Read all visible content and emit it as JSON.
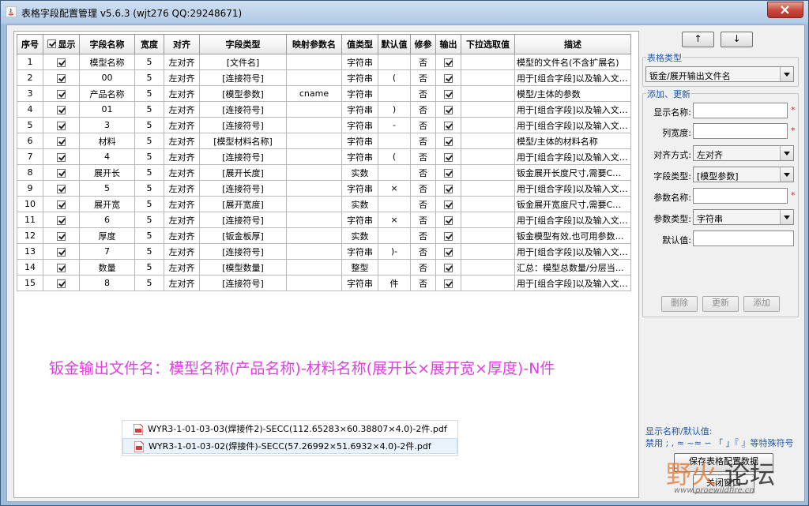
{
  "window": {
    "title": "表格字段配置管理 v5.6.3 (wjt276 QQ:29248671)"
  },
  "table": {
    "columns": [
      "序号",
      "显示",
      "字段名称",
      "宽度",
      "对齐",
      "字段类型",
      "映射参数名",
      "值类型",
      "默认值",
      "修参",
      "输出",
      "下拉选取值",
      "描述"
    ],
    "rows": [
      {
        "no": "1",
        "name": "模型名称",
        "width": "5",
        "align": "左对齐",
        "ftype": "[文件名]",
        "map": "",
        "vtype": "字符串",
        "def": "",
        "mod": "否",
        "desc": "模型的文件名(不含扩展名)"
      },
      {
        "no": "2",
        "name": "00",
        "width": "5",
        "align": "左对齐",
        "ftype": "[连接符号]",
        "map": "",
        "vtype": "字符串",
        "def": "(",
        "mod": "否",
        "desc": "用于[组合字段]以及输入文…"
      },
      {
        "no": "3",
        "name": "产品名称",
        "width": "5",
        "align": "左对齐",
        "ftype": "[模型参数]",
        "map": "cname",
        "vtype": "字符串",
        "def": "",
        "mod": "否",
        "desc": "模型/主体的参数"
      },
      {
        "no": "4",
        "name": "01",
        "width": "5",
        "align": "左对齐",
        "ftype": "[连接符号]",
        "map": "",
        "vtype": "字符串",
        "def": ")",
        "mod": "否",
        "desc": "用于[组合字段]以及输入文…"
      },
      {
        "no": "5",
        "name": "3",
        "width": "5",
        "align": "左对齐",
        "ftype": "[连接符号]",
        "map": "",
        "vtype": "字符串",
        "def": "-",
        "mod": "否",
        "desc": "用于[组合字段]以及输入文…"
      },
      {
        "no": "6",
        "name": "材料",
        "width": "5",
        "align": "左对齐",
        "ftype": "[模型材料名称]",
        "map": "",
        "vtype": "字符串",
        "def": "",
        "mod": "否",
        "desc": "模型/主体的材料名称"
      },
      {
        "no": "7",
        "name": "4",
        "width": "5",
        "align": "左对齐",
        "ftype": "[连接符号]",
        "map": "",
        "vtype": "字符串",
        "def": "(",
        "mod": "否",
        "desc": "用于[组合字段]以及输入文…"
      },
      {
        "no": "8",
        "name": "展开长",
        "width": "5",
        "align": "左对齐",
        "ftype": "[展开长度]",
        "map": "",
        "vtype": "实数",
        "def": "",
        "mod": "否",
        "desc": "钣金展开长度尺寸,需要C…"
      },
      {
        "no": "9",
        "name": "5",
        "width": "5",
        "align": "左对齐",
        "ftype": "[连接符号]",
        "map": "",
        "vtype": "字符串",
        "def": "×",
        "mod": "否",
        "desc": "用于[组合字段]以及输入文…"
      },
      {
        "no": "10",
        "name": "展开宽",
        "width": "5",
        "align": "左对齐",
        "ftype": "[展开宽度]",
        "map": "",
        "vtype": "实数",
        "def": "",
        "mod": "否",
        "desc": "钣金展开宽度尺寸,需要C…"
      },
      {
        "no": "11",
        "name": "6",
        "width": "5",
        "align": "左对齐",
        "ftype": "[连接符号]",
        "map": "",
        "vtype": "字符串",
        "def": "×",
        "mod": "否",
        "desc": "用于[组合字段]以及输入文…"
      },
      {
        "no": "12",
        "name": "厚度",
        "width": "5",
        "align": "左对齐",
        "ftype": "[钣金板厚]",
        "map": "",
        "vtype": "实数",
        "def": "",
        "mod": "否",
        "desc": "钣金模型有效,也可用参数…"
      },
      {
        "no": "13",
        "name": "7",
        "width": "5",
        "align": "左对齐",
        "ftype": "[连接符号]",
        "map": "",
        "vtype": "字符串",
        "def": ")-",
        "mod": "否",
        "desc": "用于[组合字段]以及输入文…"
      },
      {
        "no": "14",
        "name": "数量",
        "width": "5",
        "align": "左对齐",
        "ftype": "[模型数量]",
        "map": "",
        "vtype": "整型",
        "def": "",
        "mod": "否",
        "desc": "汇总：模型总数量/分层当…"
      },
      {
        "no": "15",
        "name": "8",
        "width": "5",
        "align": "左对齐",
        "ftype": "[连接符号]",
        "map": "",
        "vtype": "字符串",
        "def": "件",
        "mod": "否",
        "desc": "用于[组合字段]以及输入文…"
      }
    ]
  },
  "note": "钣金输出文件名：模型名称(产品名称)-材料名称(展开长×展开宽×厚度)-N件",
  "files": [
    "WYR3-1-01-03-03(焊接件2)-SECC(112.65283×60.38807×4.0)-2件.pdf",
    "WYR3-1-01-03-02(焊接件)-SECC(57.26992×51.6932×4.0)-2件.pdf"
  ],
  "panel": {
    "up": "↑",
    "down": "↓",
    "table_type_label": "表格类型",
    "table_type_value": "钣金/展开输出文件名",
    "add_update_label": "添加、更新",
    "display_name_label": "显示名称:",
    "col_width_label": "列宽度:",
    "align_label": "对齐方式:",
    "align_value": "左对齐",
    "field_type_label": "字段类型:",
    "field_type_value": "[模型参数]",
    "param_name_label": "参数名称:",
    "param_type_label": "参数类型:",
    "param_type_value": "字符串",
    "default_label": "默认值:",
    "required_mark": "*",
    "delete_btn": "删除",
    "update_btn": "更新",
    "add_btn": "添加",
    "note_line1": "显示名称/默认值:",
    "note_line2": "禁用 ; , ≈ ~≈ ∽ 「 」『 』等特殊符号",
    "save_btn": "保存表格配置数据",
    "close_btn": "关闭窗口"
  },
  "watermark": {
    "text_a": "野火",
    "text_b": "论坛",
    "url": "www.proewildfire.cn"
  },
  "colors": {
    "note": "#e23de5",
    "group_label": "#2257a8",
    "required": "#e02020"
  }
}
